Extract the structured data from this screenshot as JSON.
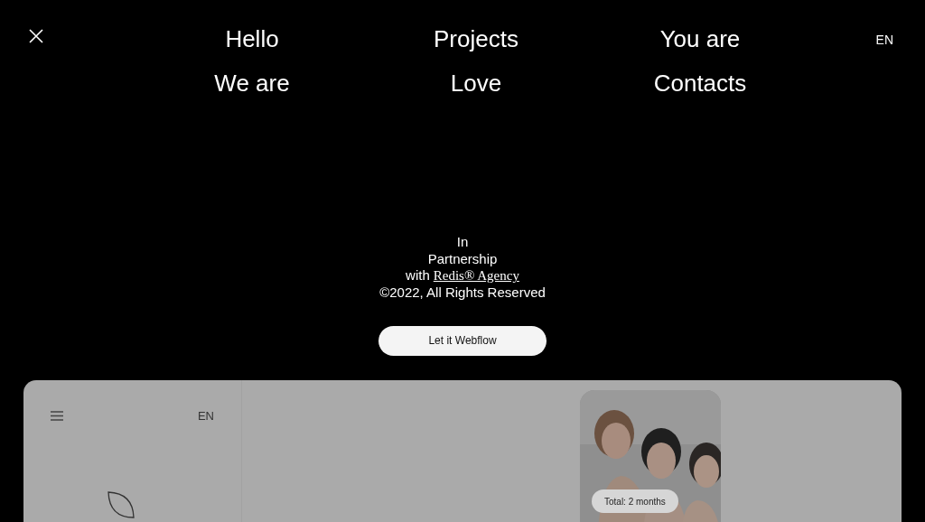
{
  "menu": [
    "Hello",
    "Projects",
    "You are",
    "We are",
    "Love",
    "Contacts"
  ],
  "language": "EN",
  "credits": {
    "line_1": "In",
    "line_2": "Partnership",
    "with": "with",
    "agency": "Redis® Agency",
    "copyright": "©2022, All Rights Reserved"
  },
  "cta": "Let it Webflow",
  "preview": {
    "language": "EN",
    "badge": "Total: 2 months"
  }
}
